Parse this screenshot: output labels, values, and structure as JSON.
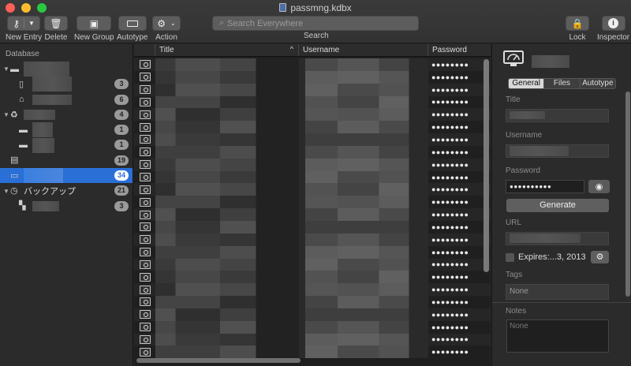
{
  "window": {
    "title": "passmng.kdbx",
    "traffic_light_colors": [
      "#fe5f57",
      "#febc2e",
      "#28c840"
    ]
  },
  "toolbar": {
    "new_entry_label": "New Entry",
    "delete_label": "Delete",
    "new_group_label": "New Group",
    "autotype_label": "Autotype",
    "action_label": "Action",
    "search_placeholder": "Search Everywhere",
    "search_label": "Search",
    "lock_label": "Lock",
    "inspector_label": "Inspector"
  },
  "sidebar": {
    "heading": "Database",
    "items": [
      {
        "label": "",
        "badge": "",
        "icon": "folder-icon",
        "level": 0,
        "caret": true
      },
      {
        "label": "",
        "badge": "3",
        "icon": "phone-icon",
        "level": 1
      },
      {
        "label": "",
        "badge": "6",
        "icon": "home-icon",
        "level": 1
      },
      {
        "label": "",
        "badge": "4",
        "icon": "recycle-icon",
        "level": 0,
        "caret": true
      },
      {
        "label": "",
        "badge": "1",
        "icon": "folder-icon",
        "level": 1
      },
      {
        "label": "",
        "badge": "1",
        "icon": "folder-icon",
        "level": 1
      },
      {
        "label": "",
        "badge": "19",
        "icon": "server-icon",
        "level": 0
      },
      {
        "label": "",
        "badge": "34",
        "icon": "monitor-icon",
        "level": 0,
        "selected": true
      },
      {
        "label": "バックアップ",
        "badge": "21",
        "icon": "clock-icon",
        "level": 0,
        "caret": true
      },
      {
        "label": "",
        "badge": "3",
        "icon": "checker-icon",
        "level": 1
      }
    ],
    "selection_color": "#2a6fd6"
  },
  "table": {
    "columns": [
      "Title",
      "Username",
      "Password"
    ],
    "sort_indicator": "^",
    "password_mask": "●●●●●●●●",
    "row_count": 24
  },
  "inspector": {
    "tabs": [
      "General",
      "Files",
      "Autotype"
    ],
    "active_tab": "General",
    "title_label": "Title",
    "username_label": "Username",
    "password_label": "Password",
    "password_value": "●●●●●●●●●●",
    "generate_label": "Generate",
    "url_label": "URL",
    "expires_label": "Expires:...3, 2013",
    "tags_label": "Tags",
    "tags_placeholder": "None",
    "notes_label": "Notes",
    "notes_placeholder": "None"
  }
}
